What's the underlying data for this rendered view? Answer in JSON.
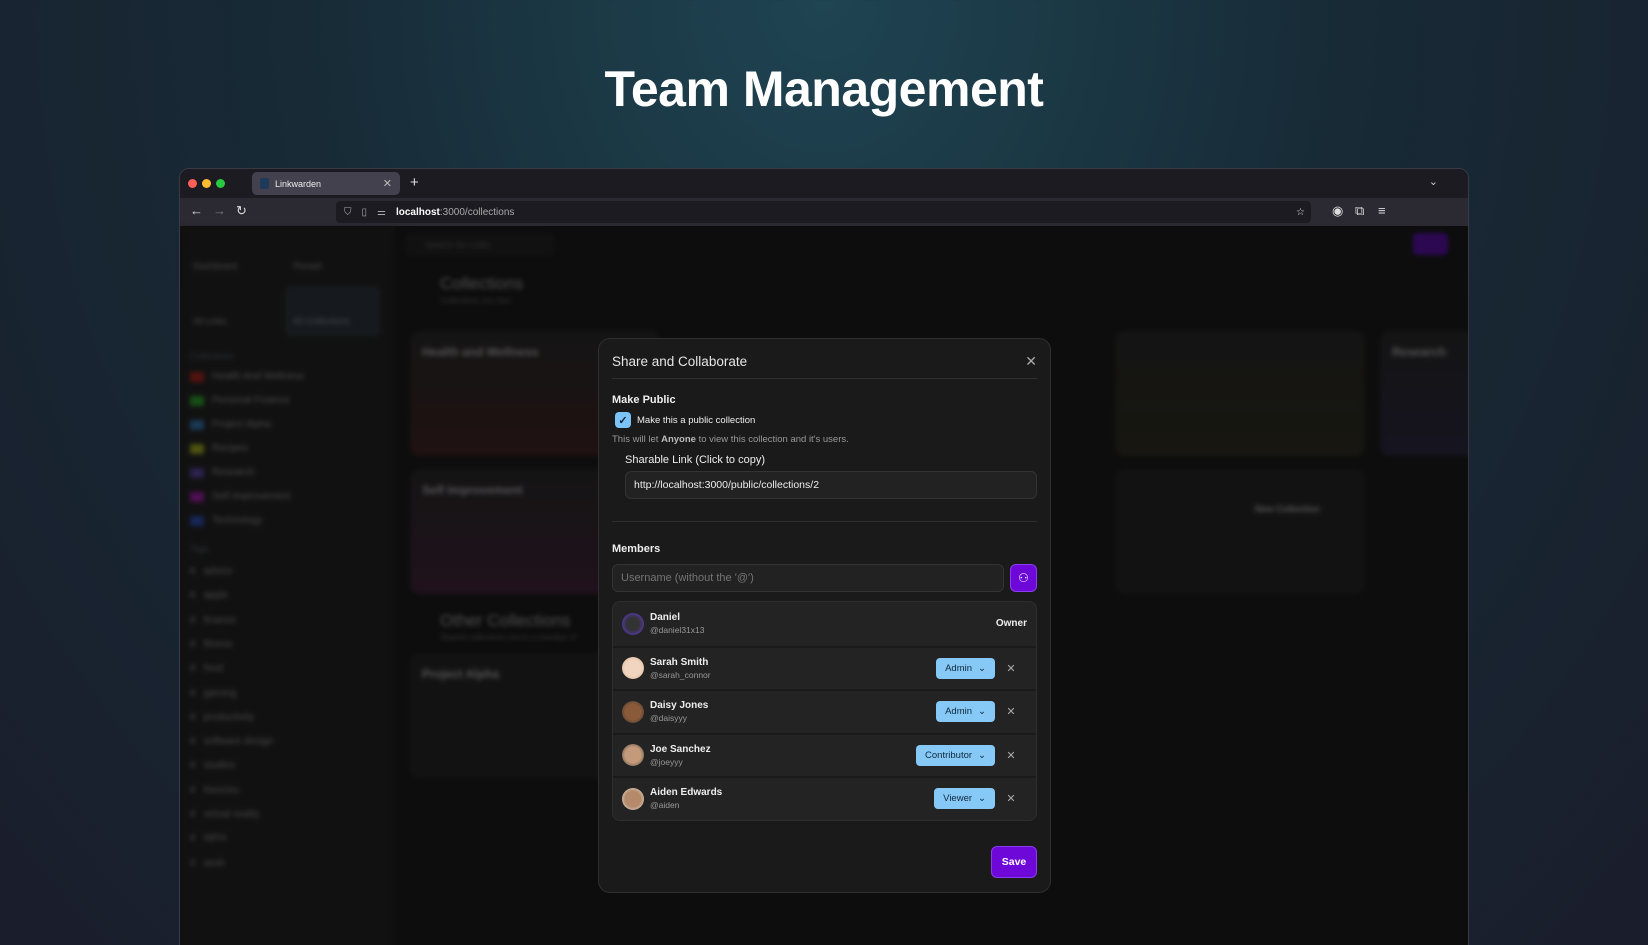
{
  "hero_title": "Team Management",
  "browser": {
    "tab_title": "Linkwarden",
    "url_host": "localhost",
    "url_path": ":3000/collections"
  },
  "sidebar": {
    "nav": [
      "Dashboard",
      "Pinned",
      "All Links",
      "All Collections"
    ],
    "collections_heading": "Collections",
    "collections": [
      {
        "label": "Health And Wellness",
        "color": "#d7261c"
      },
      {
        "label": "Personal Finance",
        "color": "#2ecc2e"
      },
      {
        "label": "Project Alpha",
        "color": "#3a8fd8"
      },
      {
        "label": "Recipes",
        "color": "#c8d81c"
      },
      {
        "label": "Research",
        "color": "#6a4fc8"
      },
      {
        "label": "Self Improvement",
        "color": "#c81cd8"
      },
      {
        "label": "Technology",
        "color": "#2e5ae0"
      }
    ],
    "tags_heading": "Tags",
    "tags": [
      "advice",
      "apple",
      "finance",
      "fitness",
      "food",
      "gaming",
      "productivity",
      "software design",
      "studies",
      "theories",
      "virtual reality",
      "WFH",
      "work"
    ]
  },
  "main": {
    "search_placeholder": "Search for Links",
    "page_title": "Collections",
    "page_subtitle": "Collections you own",
    "other_title": "Other Collections",
    "other_subtitle": "Shared collections you're a member of",
    "cards": [
      "Health and Wellness",
      "Self Improvement",
      "Research",
      "Project Alpha"
    ],
    "new_collection": "New Collection"
  },
  "modal": {
    "title": "Share and Collaborate",
    "make_public_heading": "Make Public",
    "public_checkbox_label": "Make this a public collection",
    "public_checked": true,
    "help_prefix": "This will let ",
    "help_bold": "Anyone",
    "help_suffix": " to view this collection and it's users.",
    "link_label": "Sharable Link (Click to copy)",
    "link_value": "http://localhost:3000/public/collections/2",
    "members_heading": "Members",
    "username_placeholder": "Username (without the '@')",
    "members": [
      {
        "name": "Daniel",
        "username": "@daniel31x13",
        "role": "Owner"
      },
      {
        "name": "Sarah Smith",
        "username": "@sarah_connor",
        "role": "Admin"
      },
      {
        "name": "Daisy Jones",
        "username": "@daisyyy",
        "role": "Admin"
      },
      {
        "name": "Joe Sanchez",
        "username": "@joeyyy",
        "role": "Contributor"
      },
      {
        "name": "Aiden Edwards",
        "username": "@aiden",
        "role": "Viewer"
      }
    ],
    "save_label": "Save"
  }
}
